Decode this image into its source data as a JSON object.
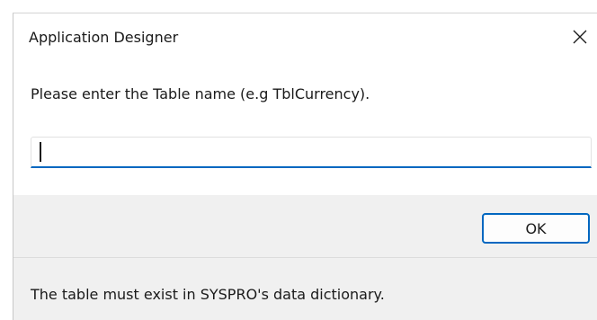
{
  "dialog": {
    "title": "Application Designer",
    "close_icon": "close-icon",
    "prompt": "Please enter the Table name (e.g TblCurrency).",
    "input": {
      "value": "",
      "placeholder": ""
    },
    "ok_label": "OK",
    "footer_note": "The table must exist in SYSPRO's data dictionary."
  },
  "colors": {
    "accent": "#0067c0",
    "dialog_background": "#f0f0f0",
    "content_background": "#ffffff"
  }
}
